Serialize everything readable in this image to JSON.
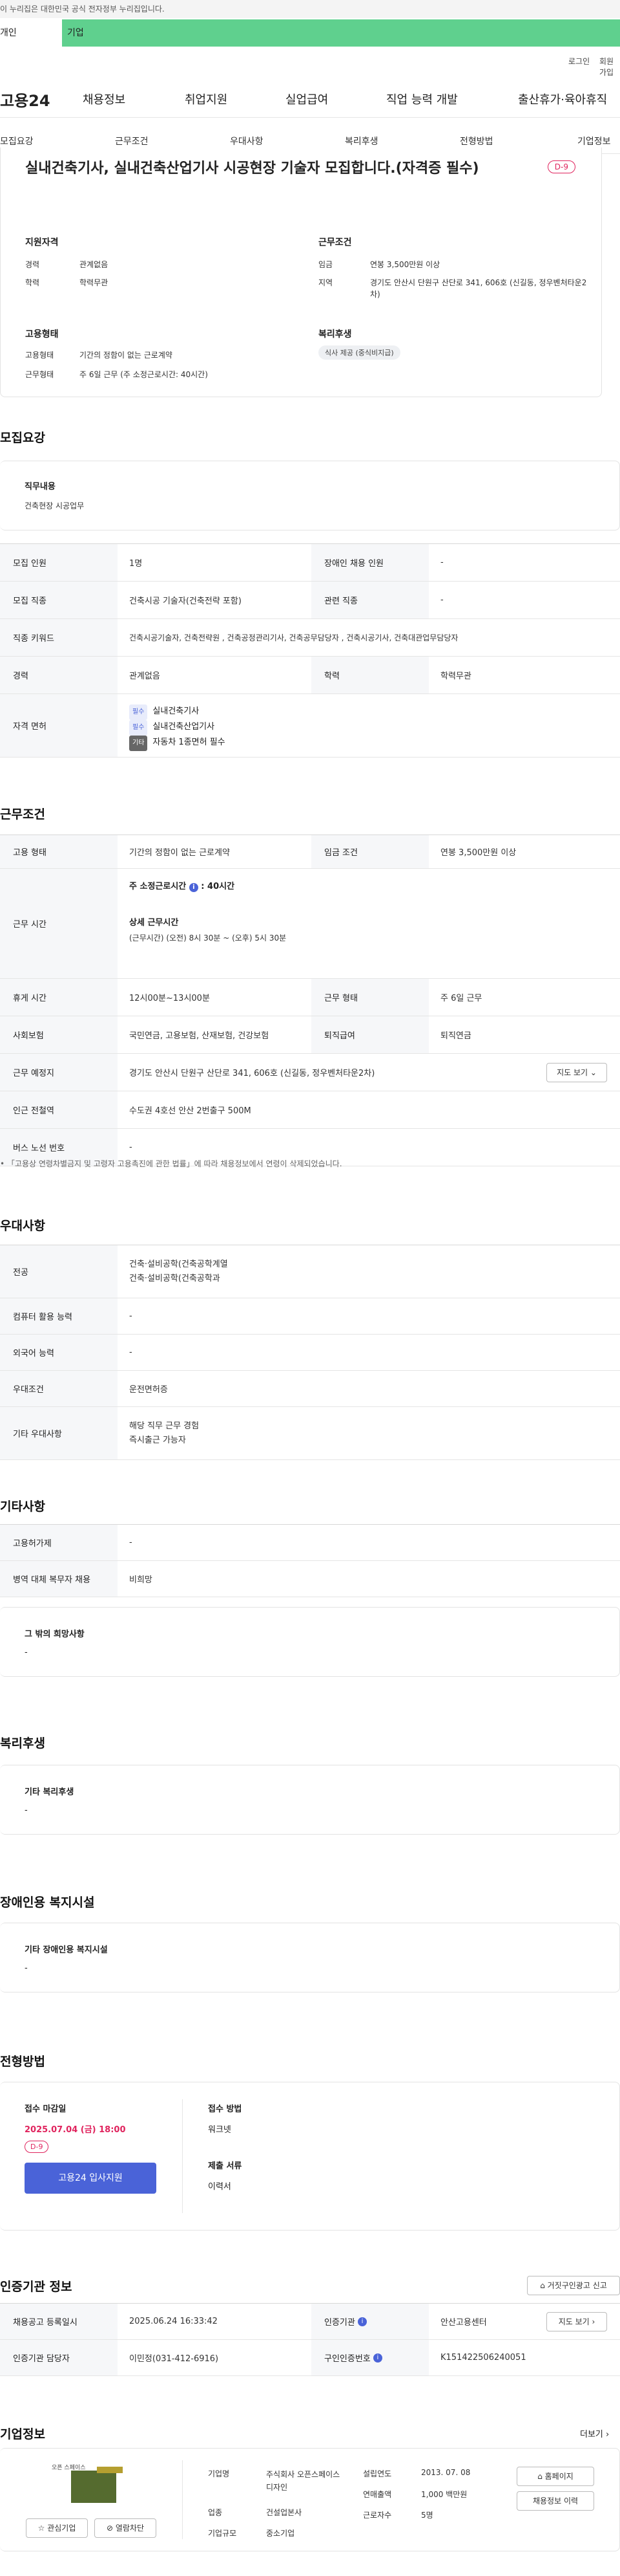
{
  "gov_notice": "이 누리집은 대한민국 공식 전자정부 누리집입니다.",
  "top_tabs": {
    "personal": "개인",
    "company": "기업"
  },
  "util": {
    "login": "로그인",
    "join": "회원가입"
  },
  "gnb": {
    "logo": "고용24",
    "items": [
      "채용정보",
      "취업지원",
      "실업급여",
      "직업 능력 개발",
      "출산휴가·육아휴직"
    ]
  },
  "subnav": [
    "모집요강",
    "근무조건",
    "우대사항",
    "복리후생",
    "전형방법",
    "기업정보"
  ],
  "summary": {
    "title": "실내건축기사, 실내건축산업기사 시공현장 기술자 모집합니다.(자격증 필수)",
    "dday": "D-9",
    "qual_title": "지원자격",
    "career_label": "경력",
    "career": "관계없음",
    "edu_label": "학력",
    "edu": "학력무관",
    "cond_title": "근무조건",
    "wage_label": "임금",
    "wage": "연봉 3,500만원 이상",
    "loc_label": "지역",
    "loc": "경기도 안산시 단원구 산단로 341, 606호 (신길동, 정우벤처타운2차)",
    "emp_title": "고용형태",
    "emp_type_label": "고용형태",
    "emp_type": "기간의 정함이 없는 근로계약",
    "work_label": "근무형태",
    "work": "주 6일 근무 (주 소정근로시간: 40시간)",
    "welfare_title": "복리후생",
    "welfare_tag": "식사 제공 (중식비지급)"
  },
  "recruit": {
    "title": "모집요강",
    "job_label": "직무내용",
    "job": "건축현장 시공업무",
    "rows": [
      [
        "모집 인원",
        "1명",
        "장애인 채용 인원",
        "-"
      ],
      [
        "모집 직종",
        "건축시공 기술자(건축전략 포함)",
        "관련 직종",
        "-"
      ],
      [
        "직종 키워드",
        "건축시공기술자, 건축전략원 , 건축공정관리기사, 건축공무담당자 , 건축시공기사, 건축대관업무담당자"
      ],
      [
        "경력",
        "관계없음",
        "학력",
        "학력무관"
      ]
    ],
    "license_label": "자격 면허",
    "licenses": [
      {
        "tag": "필수",
        "name": "실내건축기사"
      },
      {
        "tag": "필수",
        "name": "실내건축산업기사"
      },
      {
        "tag": "기타",
        "name": "자동차 1종면허 필수"
      }
    ]
  },
  "work": {
    "title": "근무조건",
    "emp_label": "고용 형태",
    "emp": "기간의 정함이 없는 근로계약",
    "wage_label": "임금 조건",
    "wage": "연봉 3,500만원 이상",
    "time_label": "근무 시간",
    "weekly": "주 소정근로시간",
    "weekly_val": "40시간",
    "detail_title": "상세 근무시간",
    "detail": "(근무시간) (오전) 8시 30분 ~ (오후) 5시 30분",
    "rows": [
      [
        "휴게 시간",
        "12시00분~13시00분",
        "근무 형태",
        "주 6일 근무"
      ],
      [
        "사회보험",
        "국민연금, 고용보험, 산재보험, 건강보험",
        "퇴직급여",
        "퇴직연금"
      ]
    ],
    "place_label": "근무 예정지",
    "place": "경기도 안산시 단원구 산단로 341, 606호 (신길동, 정우벤처타운2차)",
    "map_btn": "지도 보기",
    "station_label": "인근 전철역",
    "station": "수도권 4호선 안산 2번출구 500M",
    "bus_label": "버스 노선 번호",
    "bus": "-",
    "note": "「고용상 연령차별금지 및 고령자 고용촉진에 관한 법률」에 따라 채용정보에서 연령이 삭제되었습니다."
  },
  "pref": {
    "title": "우대사항",
    "rows": [
      [
        "전공",
        "건축·설비공학(건축공학계열\n건축·설비공학(건축공학과"
      ],
      [
        "컴퓨터 활용 능력",
        "-"
      ],
      [
        "외국어 능력",
        "-"
      ],
      [
        "우대조건",
        "운전면허증"
      ],
      [
        "기타 우대사항",
        "해당 직무 근무 경험\n즉시출근 가능자"
      ]
    ]
  },
  "etc": {
    "title": "기타사항",
    "rows": [
      [
        "고용허가제",
        "-"
      ],
      [
        "병역 대체 복무자 채용",
        "비희망"
      ]
    ],
    "hope_label": "그 밖의 희망사항",
    "hope": "-"
  },
  "benefit": {
    "title": "복리후생",
    "label": "기타 복리후생",
    "val": "-"
  },
  "disabled": {
    "title": "장애인용 복지시설",
    "label": "기타 장애인용 복지시설",
    "val": "-"
  },
  "screening": {
    "title": "전형방법",
    "deadline_label": "접수 마감일",
    "deadline": "2025.07.04 (금) 18:00",
    "dday": "D-9",
    "apply_btn": "고용24 입사지원",
    "method_label": "접수 방법",
    "method": "워크넷",
    "docs_label": "제출 서류",
    "docs": "이력서"
  },
  "agency": {
    "title": "인증기관 정보",
    "report_btn": "거짓구인광고 신고",
    "reg_label": "채용공고 등록일시",
    "reg": "2025.06.24 16:33:42",
    "org_label": "인증기관",
    "org": "안산고용센터",
    "map_btn": "지도 보기",
    "mgr_label": "인증기관 담당자",
    "mgr": "이민정(031-412-6916)",
    "no_label": "구인인증번호",
    "no": "K151422506240051"
  },
  "company": {
    "title": "기업정보",
    "more": "더보기",
    "logo_text": "오픈 스페이스",
    "fav_btn": "관심기업",
    "block_btn": "열람차단",
    "name_label": "기업명",
    "name": "주식회사 오픈스페이스디자인",
    "est_label": "설립연도",
    "est": "2013. 07. 08",
    "ind_label": "업종",
    "ind": "건설업본사",
    "sales_label": "연매출액",
    "sales": "1,000 백만원",
    "size_label": "기업규모",
    "size": "중소기업",
    "emp_label": "근로자수",
    "emp": "5명",
    "home_btn": "홈페이지",
    "hist_btn": "채용정보 이력"
  },
  "colors": {
    "green": "#5fd08e",
    "blue": "#4a63d8",
    "red": "#e0245e"
  }
}
